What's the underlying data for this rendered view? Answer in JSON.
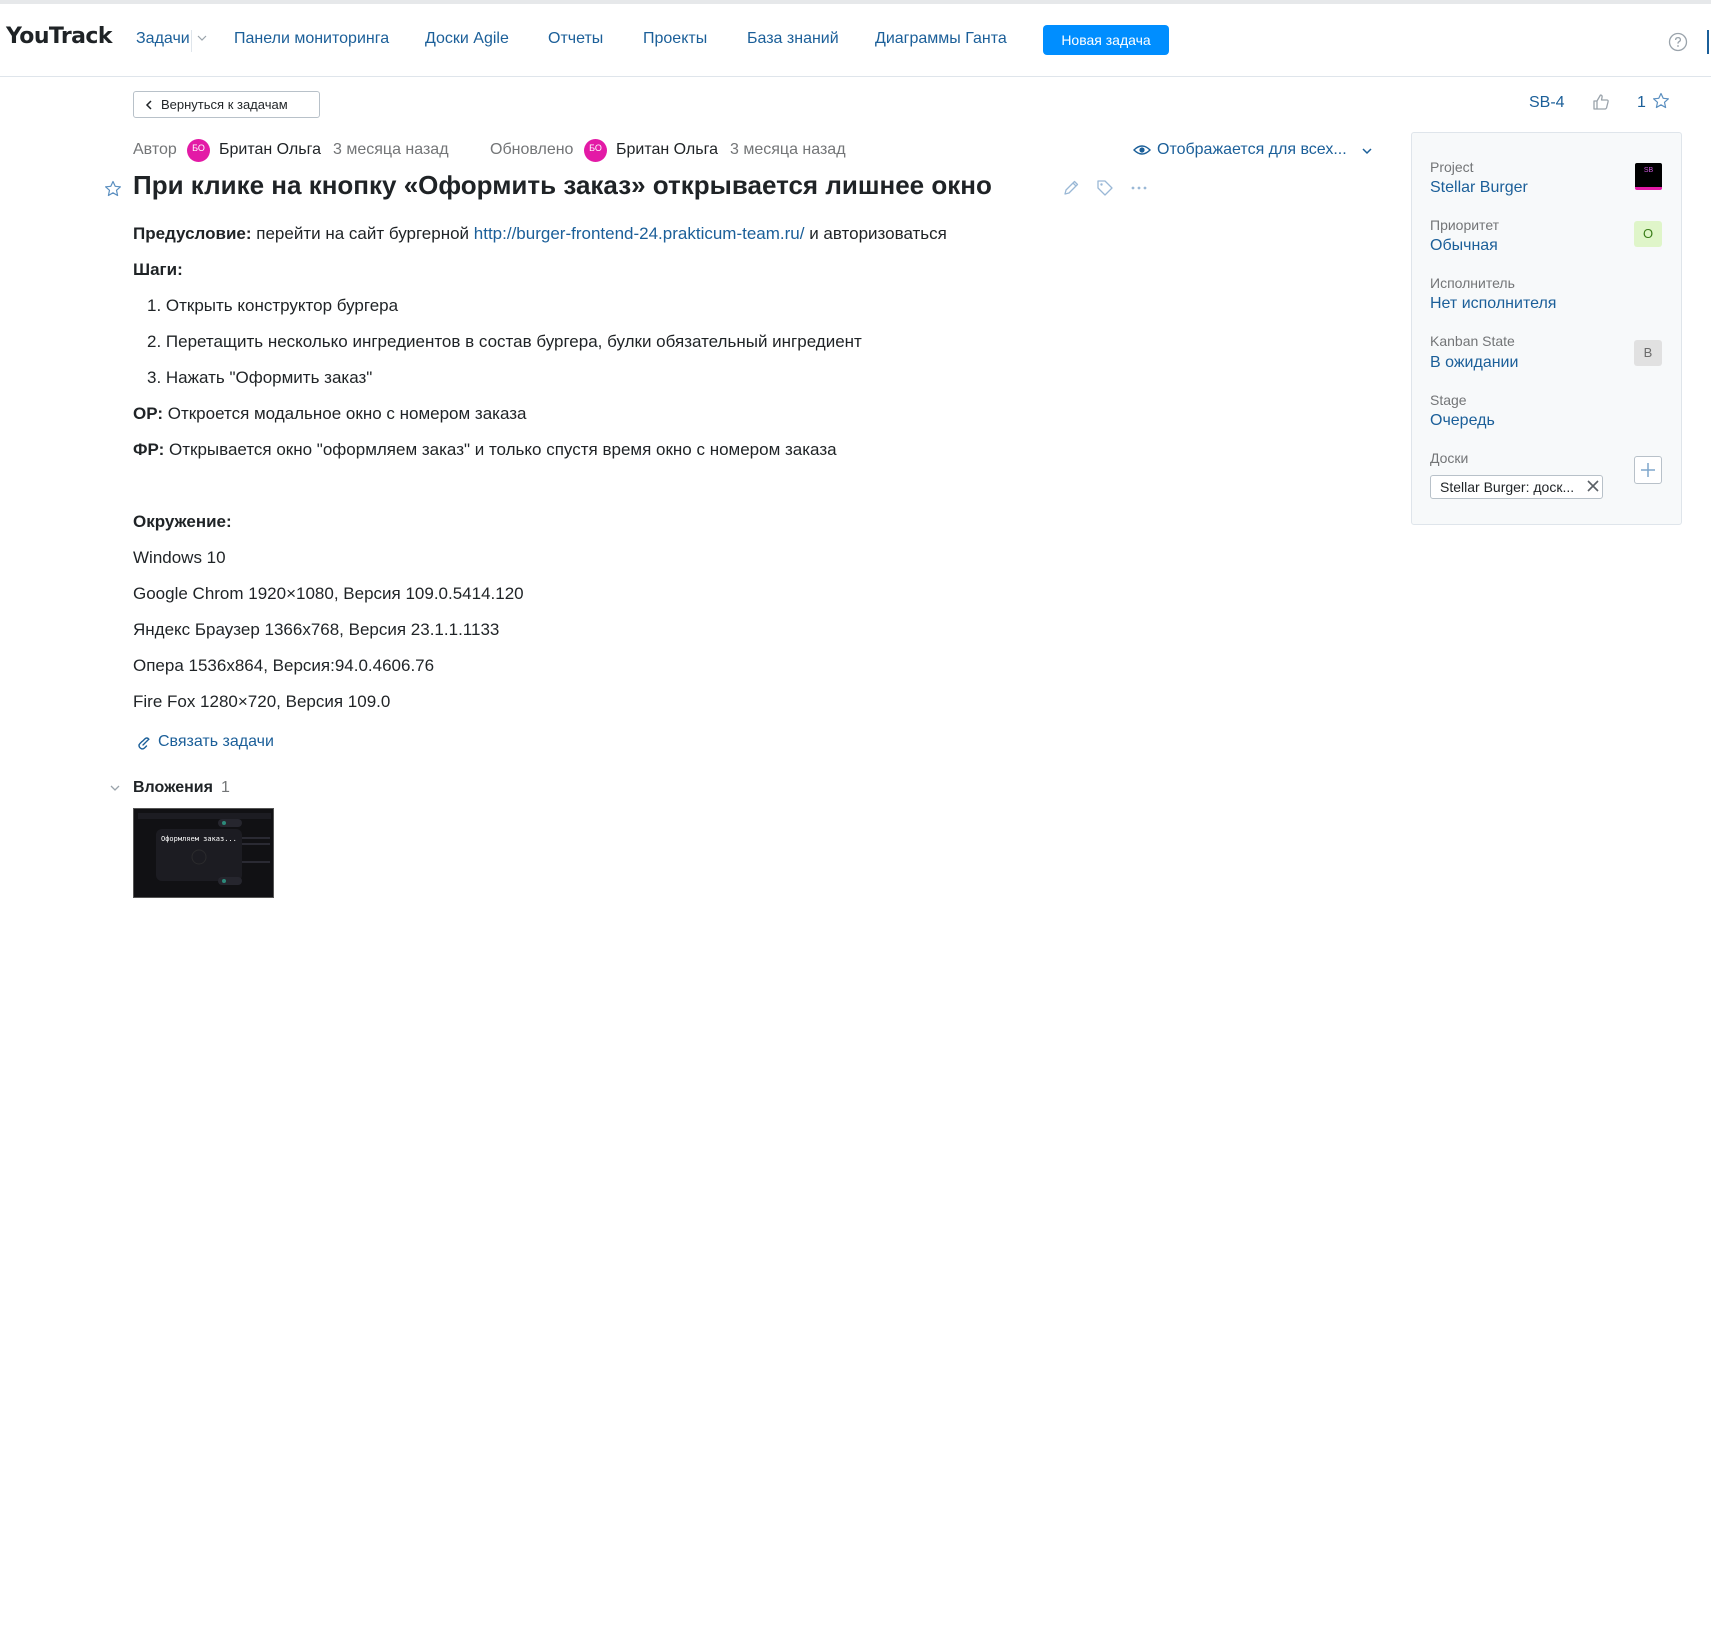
{
  "header": {
    "logo": "YouTrack",
    "nav": [
      "Задачи",
      "Панели мониторинга",
      "Доски Agile",
      "Отчеты",
      "Проекты",
      "База знаний",
      "Диаграммы Ганта"
    ],
    "new_task": "Новая задача"
  },
  "toolbar": {
    "back_label": "Вернуться к задачам",
    "issue_id": "SB-4",
    "star_count": "1"
  },
  "meta": {
    "author_label": "Автор",
    "author_initials": "БО",
    "author_name": "Британ Ольга",
    "author_time": "3 месяца назад",
    "updated_label": "Обновлено",
    "updater_initials": "БО",
    "updater_name": "Британ Ольга",
    "updated_time": "3 месяца назад",
    "visibility": "Отображается для всех..."
  },
  "issue": {
    "title": "При клике на кнопку «Оформить заказ» открывается лишнее окно",
    "precondition_label": "Предусловие:",
    "precondition_text": " перейти на сайт бургерной ",
    "precondition_link": "http://burger-frontend-24.prakticum-team.ru/",
    "precondition_tail": " и авторизоваться",
    "steps_label": "Шаги:",
    "steps": [
      "1. Открыть конструктор бургера",
      "2. Перетащить несколько ингредиентов в состав бургера, булки обязательный ингредиент",
      "3. Нажать \"Оформить заказ\""
    ],
    "expected_label": "ОР:",
    "expected_text": " Откроется модальное окно с номером заказа",
    "actual_label": "ФР:",
    "actual_text": " Открывается окно \"оформляем заказ\" и только спустя время окно с номером заказа",
    "environment_label": "Окружение:",
    "environment": [
      "Windows 10",
      "Google Chrom 1920×1080, Версия 109.0.5414.120",
      "Яндекс Браузер 1366х768, Версия 23.1.1.1133",
      "Опера 1536х864, Версия:94.0.4606.76",
      "Fire Fox 1280×720, Версия 109.0"
    ],
    "link_tasks": "Связать задачи",
    "attachments_label": "Вложения",
    "attachments_count": "1",
    "attachment_thumb_text": "Оформляем заказ..."
  },
  "fields": {
    "project_label": "Project",
    "project_value": "Stellar Burger",
    "project_logo": "SB",
    "priority_label": "Приоритет",
    "priority_value": "Обычная",
    "priority_badge": "O",
    "assignee_label": "Исполнитель",
    "assignee_value": "Нет исполнителя",
    "kanban_label": "Kanban State",
    "kanban_value": "В ожидании",
    "kanban_badge": "B",
    "stage_label": "Stage",
    "stage_value": "Очередь",
    "boards_label": "Доски",
    "board_tag": "Stellar Burger: доск..."
  },
  "colors": {
    "accent": "#008eff",
    "link": "#1b5f99",
    "avatar": "#e31aa6",
    "muted": "#737577"
  }
}
